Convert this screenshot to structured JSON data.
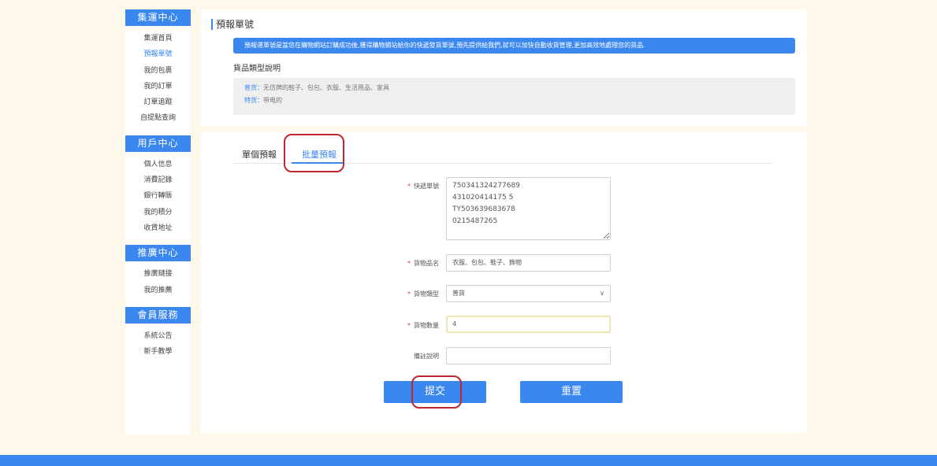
{
  "sidebar": {
    "groups": [
      {
        "title": "集運中心",
        "items": [
          "集運首頁",
          "預報單號",
          "我的包裹",
          "我的訂單",
          "訂單追蹤",
          "自提點查詢"
        ]
      },
      {
        "title": "用戶中心",
        "items": [
          "個人信息",
          "消費記錄",
          "銀行轉賬",
          "我的積分",
          "收貨地址"
        ]
      },
      {
        "title": "推廣中心",
        "items": [
          "推廣鏈接",
          "我的推薦"
        ]
      },
      {
        "title": "會員服務",
        "items": [
          "系統公告",
          "新手教學"
        ]
      }
    ],
    "active_item": "預報單號"
  },
  "header": {
    "title": "預報單號",
    "notice": "預報運單號是當您在購物網站訂購成功後,獲得購物網站給你的快遞發貨單號,預先提供給我們,就可以加快自動收貨管理,更加高效地處理您的貨品.",
    "types_title": "貨品類型說明",
    "types": [
      {
        "key": "普货：",
        "value": "无仿牌的鞋子、包包、衣服、生活用品、家具"
      },
      {
        "key": "特货：",
        "value": "带电的"
      }
    ]
  },
  "tabs": {
    "single": "單個預報",
    "batch": "批量預報"
  },
  "form": {
    "tracking_label": "快遞單號",
    "tracking_value": "750341324277689\n431020414175 5\nTY5036396836 78\n0215487265",
    "tracking_lines": [
      "750341324277689",
      "431020414175 5",
      "TY503639683678",
      "0215487265"
    ],
    "name_label": "貨物品名",
    "name_value": "衣服、包包、鞋子、飾物",
    "type_label": "貨物類型",
    "type_value": "普貨",
    "qty_label": "貨物數量",
    "qty_value": "4",
    "remark_label": "備註說明",
    "remark_value": "",
    "submit": "提交",
    "reset": "重置"
  },
  "colors": {
    "accent": "#3b87f0",
    "background": "#fdf8ea",
    "annotation": "#c0272d"
  }
}
